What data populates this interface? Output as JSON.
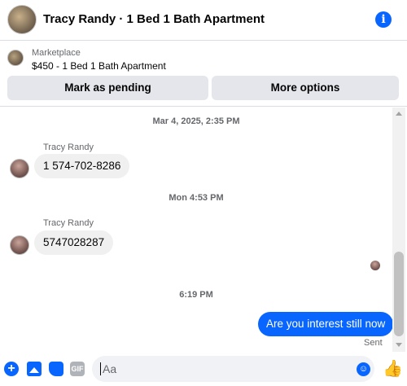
{
  "header": {
    "title": "Tracy Randy · 1 Bed 1 Bath Apartment"
  },
  "listing": {
    "subtitle": "Marketplace",
    "price_line": "$450 - 1 Bed 1 Bath Apartment",
    "mark_pending_label": "Mark as pending",
    "more_options_label": "More options"
  },
  "chat": {
    "timestamps": [
      "Mar 4, 2025, 2:35 PM",
      "Mon 4:53 PM",
      "6:19 PM"
    ],
    "messages": [
      {
        "sender": "Tracy Randy",
        "text": "1 574-702-8286"
      },
      {
        "sender": "Tracy Randy",
        "text": "5747028287"
      },
      {
        "sender": "me",
        "text": "Are you interest still now",
        "status": "Sent"
      }
    ]
  },
  "composer": {
    "placeholder": "Aa",
    "gif_label": "GIF"
  },
  "colors": {
    "accent": "#0866ff",
    "bubble_in": "#f0f0f0",
    "muted": "#65676b"
  },
  "icons": [
    "info-icon",
    "plus-icon",
    "photo-icon",
    "sticker-icon",
    "gif-icon",
    "emoji-icon",
    "like-icon"
  ]
}
